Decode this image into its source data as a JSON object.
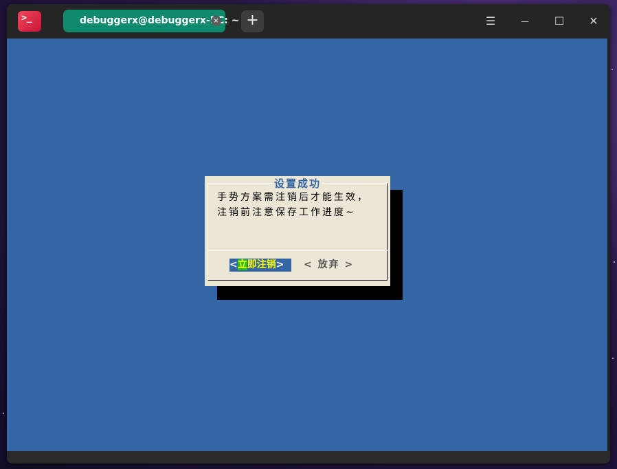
{
  "titlebar": {
    "app_icon_glyph": ">_",
    "tab_label": "debuggerx@debuggerx-PC: ~",
    "tab_close_glyph": "×",
    "new_tab_glyph": "+",
    "menu_glyph": "☰",
    "minimize_glyph": "—",
    "maximize_glyph": "☐",
    "close_glyph": "✕"
  },
  "dialog": {
    "title": "设置成功",
    "message_line1": "手势方案需注销后才能生效，",
    "message_line2": "注销前注意保存工作进度~",
    "ok_open": "<",
    "ok_hotkey": "立",
    "ok_rest": "即注销",
    "ok_close": ">",
    "cancel_label": "<  放弃  >"
  },
  "colors": {
    "terminal_bg": "#3465a4",
    "tab_bg": "#0f8a6c",
    "dialog_bg": "#ebe6d6",
    "hotkey_bg": "#22c022",
    "hotkey_fg": "#ffff00"
  }
}
